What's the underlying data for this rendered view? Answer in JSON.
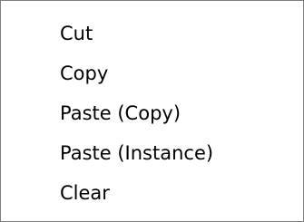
{
  "menu": {
    "items": [
      {
        "label": "Cut"
      },
      {
        "label": "Copy"
      },
      {
        "label": "Paste (Copy)"
      },
      {
        "label": "Paste (Instance)"
      },
      {
        "label": "Clear"
      }
    ]
  }
}
